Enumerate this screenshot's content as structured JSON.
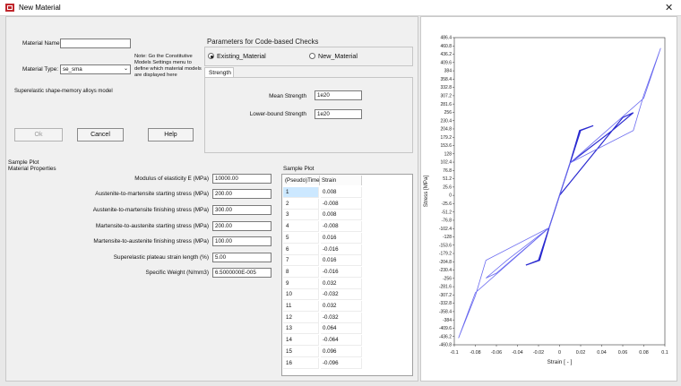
{
  "window": {
    "title": "New Material",
    "close_glyph": "✕"
  },
  "form": {
    "material_name_label": "Material Name:",
    "material_name_value": "",
    "material_type_label": "Material Type:",
    "material_type_value": "se_sma",
    "note_text": "Note: Go the Constitutive Models Settings menu to define which material models are displayed here",
    "model_description": "Superelastic shape-memory alloys model"
  },
  "buttons": {
    "ok": "Ok",
    "cancel": "Cancel",
    "help": "Help"
  },
  "code_checks": {
    "title": "Parameters for Code-based Checks",
    "radio_existing": "Existing_Material",
    "radio_new": "New_Material",
    "selected": "existing",
    "tab_label": "Strength",
    "mean_strength_label": "Mean Strength",
    "mean_strength_value": "1e20",
    "lower_bound_label": "Lower-bound Strength",
    "lower_bound_value": "1e20"
  },
  "sample_plot_header": "Sample Plot",
  "properties": {
    "section_title": "Material Properties",
    "rows": [
      {
        "label": "Modulus of elasticity E (MPa)",
        "value": "10000.00"
      },
      {
        "label": "Austenite-to-martensite starting stress (MPa)",
        "value": "200.00"
      },
      {
        "label": "Austenite-to-martensite finishing stress (MPa)",
        "value": "300.00"
      },
      {
        "label": "Martensite-to-austenite starting stress (MPa)",
        "value": "200.00"
      },
      {
        "label": "Martensite-to-austenite finishing stress (MPa)",
        "value": "100.00"
      },
      {
        "label": "Superelastic plateau strain length (%)",
        "value": "5.00"
      },
      {
        "label": "Specific Weight (N/mm3)",
        "value": "6.5000000E-005"
      }
    ]
  },
  "sample_table": {
    "title": "Sample Plot",
    "headers": [
      "(Pseudo)Time",
      "Strain"
    ],
    "rows": [
      [
        "1",
        "0.008"
      ],
      [
        "2",
        "-0.008"
      ],
      [
        "3",
        "0.008"
      ],
      [
        "4",
        "-0.008"
      ],
      [
        "5",
        "0.016"
      ],
      [
        "6",
        "-0.016"
      ],
      [
        "7",
        "0.016"
      ],
      [
        "8",
        "-0.016"
      ],
      [
        "9",
        "0.032"
      ],
      [
        "10",
        "-0.032"
      ],
      [
        "11",
        "0.032"
      ],
      [
        "12",
        "-0.032"
      ],
      [
        "13",
        "0.064"
      ],
      [
        "14",
        "-0.064"
      ],
      [
        "15",
        "0.096"
      ],
      [
        "16",
        "-0.096"
      ]
    ],
    "selected_row": 0
  },
  "chart_data": {
    "type": "line",
    "xlabel": "Strain [ - ]",
    "ylabel": "Stress [MPa]",
    "xlim": [
      -0.1,
      0.1
    ],
    "ylim": [
      -460.8,
      486.4
    ],
    "x_ticks": [
      -0.1,
      -0.08,
      -0.06,
      -0.04,
      -0.02,
      0,
      0.02,
      0.04,
      0.06,
      0.08,
      0.1
    ],
    "x_tick_labels": [
      "-0.1",
      "-0.08",
      "-0.06",
      "-0.04",
      "-0.02",
      "0",
      "0.02",
      "0.04",
      "0.06",
      "0.08",
      "0.1"
    ],
    "y_tick_labels": [
      "486.4",
      "460.8",
      "436.2",
      "409.6",
      "384",
      "358.4",
      "332.8",
      "307.2",
      "281.6",
      "256",
      "230.4",
      "204.8",
      "179.2",
      "153.6",
      "128",
      "102.4",
      "76.8",
      "51.2",
      "25.6",
      "0",
      "-25.6",
      "-51.2",
      "-76.8",
      "-102.4",
      "-128",
      "-153.6",
      "-179.2",
      "-204.8",
      "-230.4",
      "-256",
      "-281.6",
      "-307.2",
      "-332.8",
      "-358.4",
      "-384",
      "-409.6",
      "-436.2",
      "-460.8"
    ],
    "series": [
      {
        "color": "#2a2ad0",
        "x": [
          0,
          0.02,
          0.032,
          0.019,
          0.01,
          -0.01,
          -0.02,
          -0.032,
          -0.019,
          -0.01,
          0,
          0.06,
          0.07,
          0.05,
          0.01
        ],
        "y": [
          0,
          200,
          215,
          200,
          100,
          -100,
          -200,
          -215,
          -200,
          -100,
          0,
          240,
          255,
          200,
          100
        ]
      },
      {
        "color": "#6a6af0",
        "x": [
          0.01,
          -0.01,
          -0.06,
          -0.07,
          -0.05,
          -0.01,
          0.01,
          0.08,
          0.096,
          0.08,
          0.07,
          0.01
        ],
        "y": [
          100,
          -100,
          -240,
          -255,
          -200,
          -100,
          100,
          300,
          454,
          310,
          200,
          100
        ]
      },
      {
        "color": "#6a6af0",
        "x": [
          -0.01,
          -0.08,
          -0.096,
          -0.08,
          -0.07,
          -0.01
        ],
        "y": [
          -100,
          -300,
          -440,
          -310,
          -200,
          -100
        ]
      }
    ]
  }
}
